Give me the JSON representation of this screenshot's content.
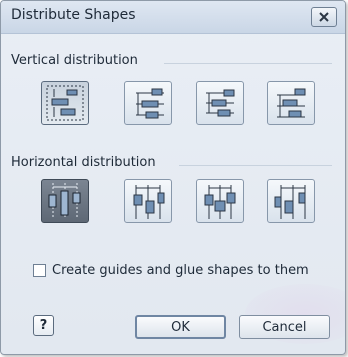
{
  "dialog": {
    "title": "Distribute Shapes",
    "close_icon": "close-icon"
  },
  "vertical": {
    "label": "Vertical distribution",
    "options": [
      {
        "name": "distribute-vertical-space",
        "selected": true
      },
      {
        "name": "distribute-vertical-top",
        "selected": false
      },
      {
        "name": "distribute-vertical-center",
        "selected": false
      },
      {
        "name": "distribute-vertical-bottom",
        "selected": false
      }
    ]
  },
  "horizontal": {
    "label": "Horizontal distribution",
    "options": [
      {
        "name": "distribute-horizontal-space",
        "selected": true
      },
      {
        "name": "distribute-horizontal-left",
        "selected": false
      },
      {
        "name": "distribute-horizontal-center",
        "selected": false
      },
      {
        "name": "distribute-horizontal-right",
        "selected": false
      }
    ]
  },
  "guides": {
    "label": "Create guides and glue shapes to them",
    "checked": false
  },
  "buttons": {
    "help_label": "?",
    "ok_label": "OK",
    "cancel_label": "Cancel"
  }
}
